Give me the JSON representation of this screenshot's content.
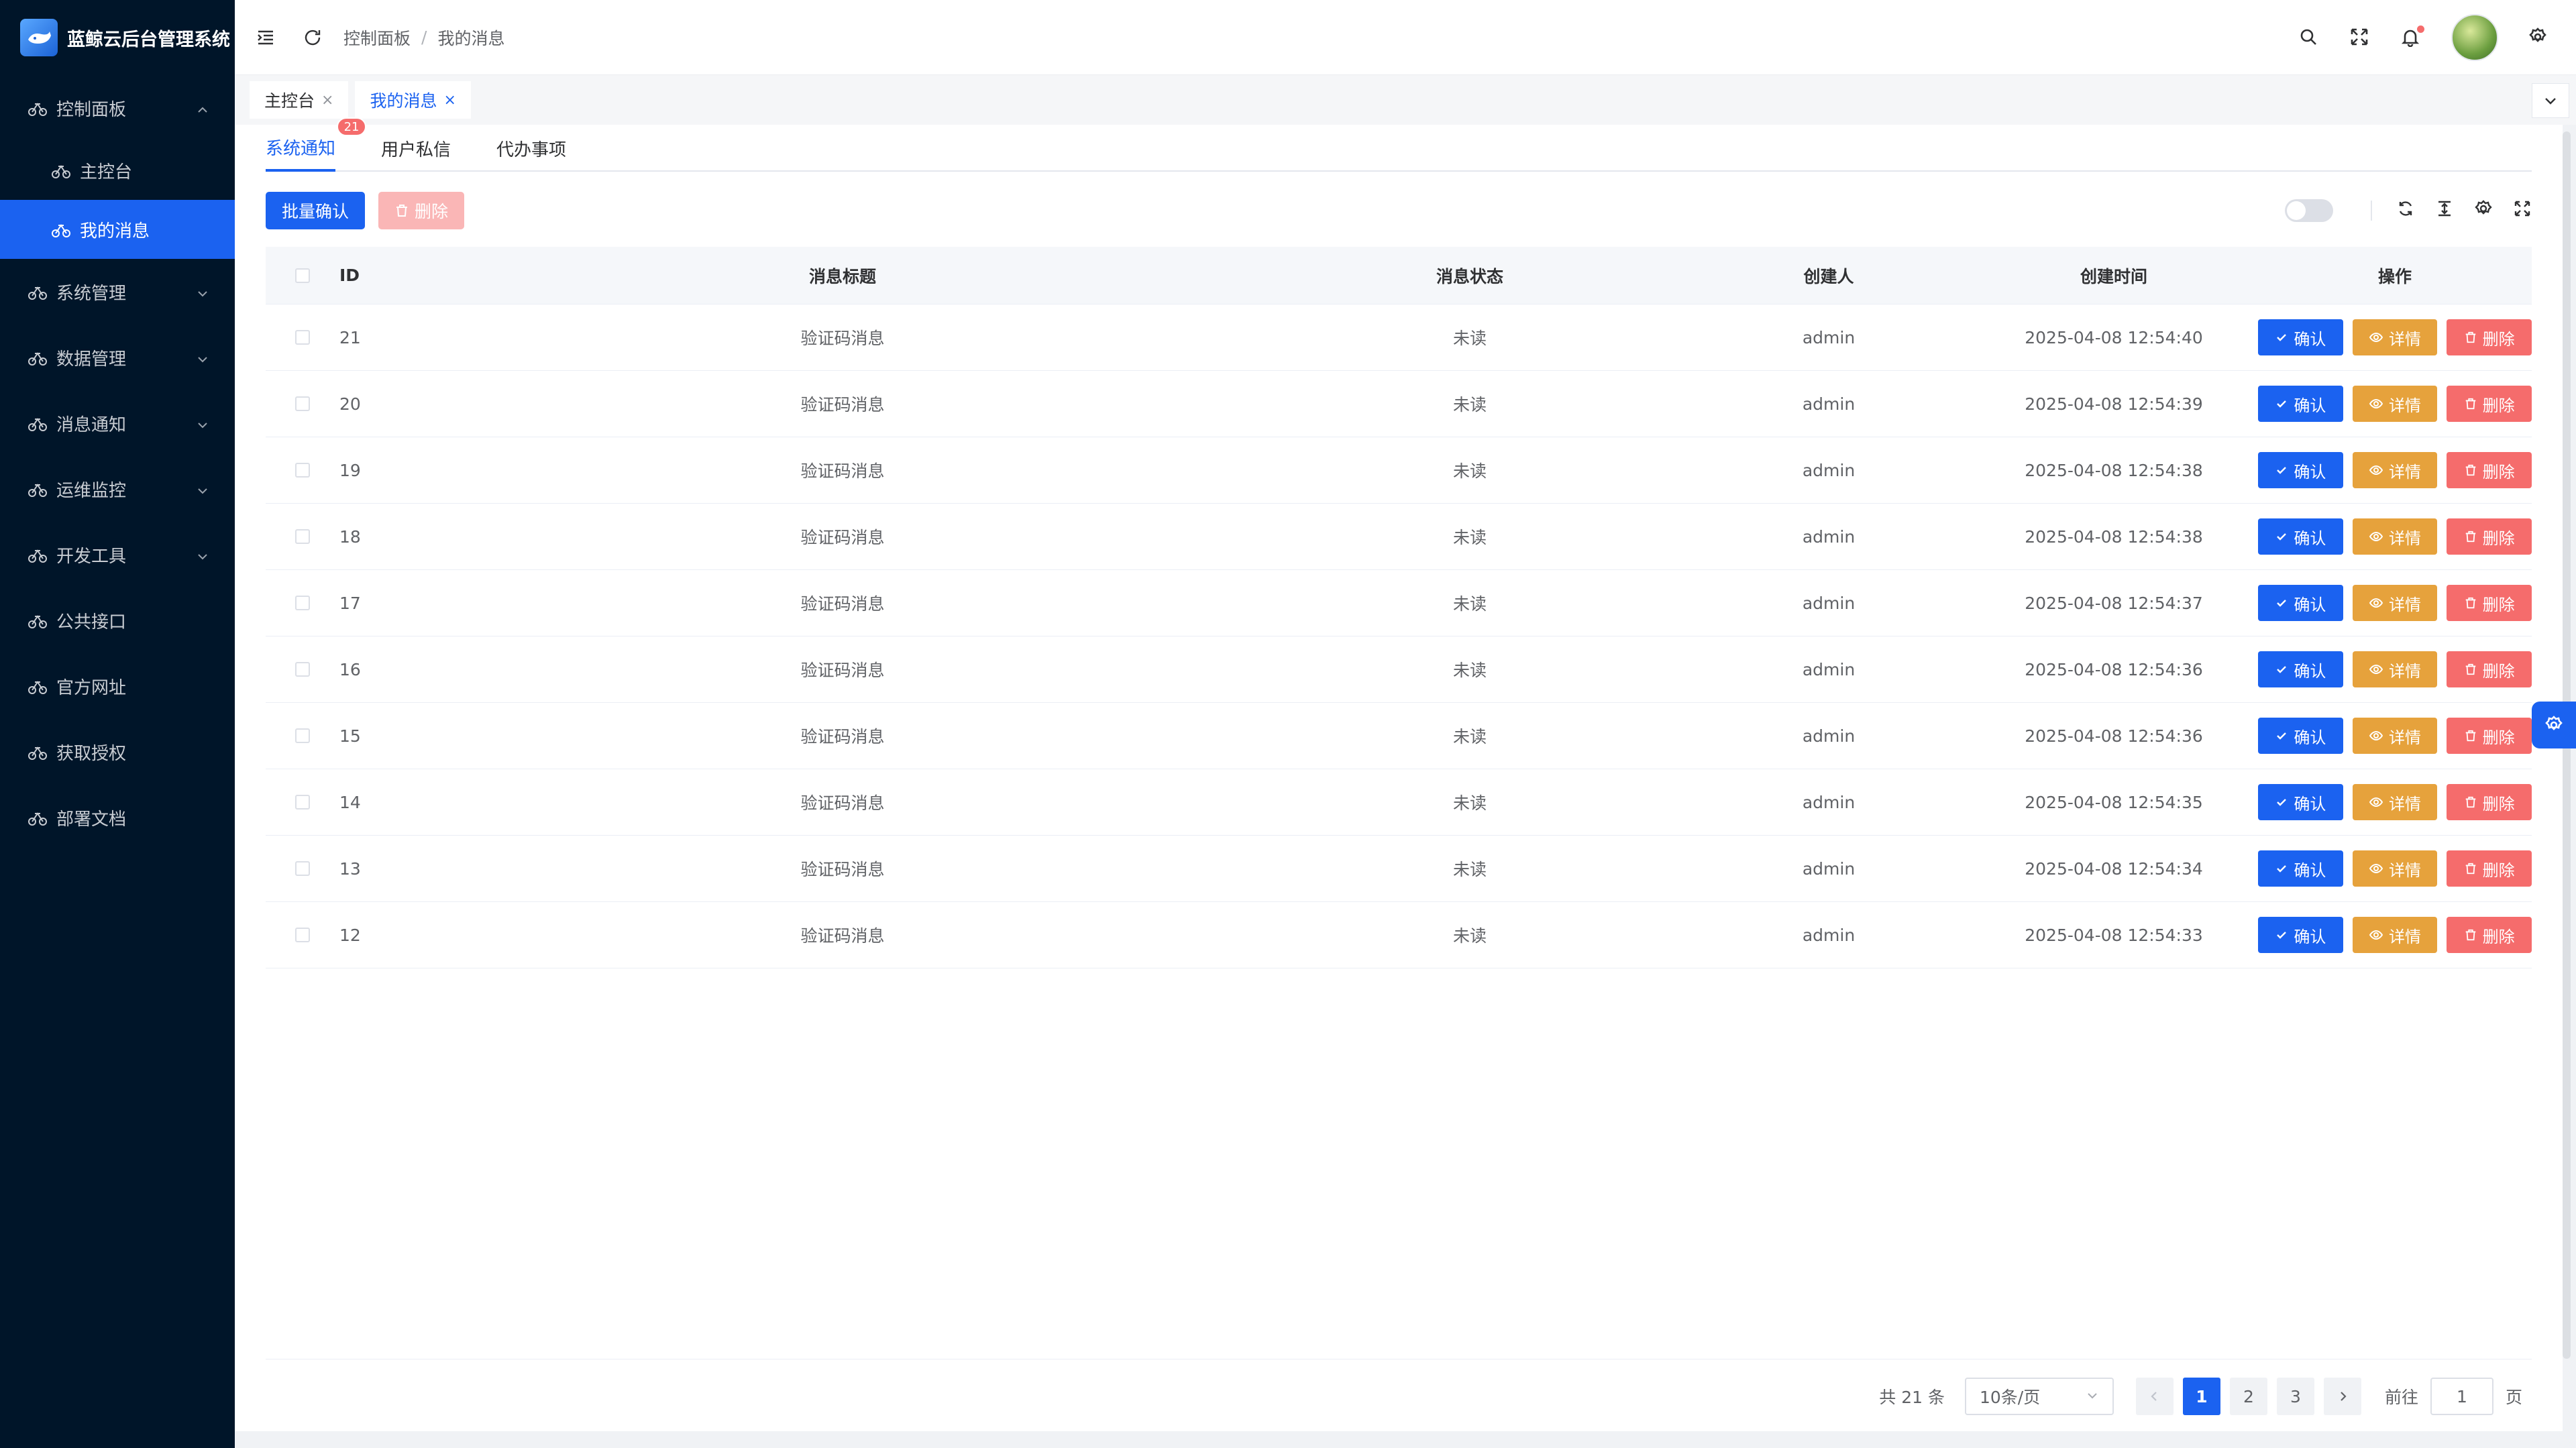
{
  "app": {
    "title": "蓝鲸云后台管理系统"
  },
  "sidebar": {
    "items": [
      {
        "label": "控制面板",
        "expanded": true
      },
      {
        "label": "主控台",
        "sub": true
      },
      {
        "label": "我的消息",
        "sub": true,
        "active": true
      },
      {
        "label": "系统管理",
        "hasChildren": true
      },
      {
        "label": "数据管理",
        "hasChildren": true
      },
      {
        "label": "消息通知",
        "hasChildren": true
      },
      {
        "label": "运维监控",
        "hasChildren": true
      },
      {
        "label": "开发工具",
        "hasChildren": true
      },
      {
        "label": "公共接口"
      },
      {
        "label": "官方网址"
      },
      {
        "label": "获取授权"
      },
      {
        "label": "部署文档"
      }
    ]
  },
  "header": {
    "breadcrumb": [
      "控制面板",
      "我的消息"
    ],
    "separator": "/"
  },
  "tags": [
    {
      "label": "主控台",
      "close": "×"
    },
    {
      "label": "我的消息",
      "close": "×",
      "active": true
    }
  ],
  "subtabs": [
    {
      "label": "系统通知",
      "badge": "21",
      "active": true
    },
    {
      "label": "用户私信"
    },
    {
      "label": "代办事项"
    }
  ],
  "toolbar": {
    "batch_confirm": "批量确认",
    "delete": "删除"
  },
  "table": {
    "headers": {
      "id": "ID",
      "title": "消息标题",
      "status": "消息状态",
      "creator": "创建人",
      "time": "创建时间",
      "ops": "操作"
    },
    "ops": {
      "confirm": "确认",
      "detail": "详情",
      "delete": "删除"
    },
    "rows": [
      {
        "id": "21",
        "title": "验证码消息",
        "status": "未读",
        "creator": "admin",
        "time": "2025-04-08 12:54:40"
      },
      {
        "id": "20",
        "title": "验证码消息",
        "status": "未读",
        "creator": "admin",
        "time": "2025-04-08 12:54:39"
      },
      {
        "id": "19",
        "title": "验证码消息",
        "status": "未读",
        "creator": "admin",
        "time": "2025-04-08 12:54:38"
      },
      {
        "id": "18",
        "title": "验证码消息",
        "status": "未读",
        "creator": "admin",
        "time": "2025-04-08 12:54:38"
      },
      {
        "id": "17",
        "title": "验证码消息",
        "status": "未读",
        "creator": "admin",
        "time": "2025-04-08 12:54:37"
      },
      {
        "id": "16",
        "title": "验证码消息",
        "status": "未读",
        "creator": "admin",
        "time": "2025-04-08 12:54:36"
      },
      {
        "id": "15",
        "title": "验证码消息",
        "status": "未读",
        "creator": "admin",
        "time": "2025-04-08 12:54:36"
      },
      {
        "id": "14",
        "title": "验证码消息",
        "status": "未读",
        "creator": "admin",
        "time": "2025-04-08 12:54:35"
      },
      {
        "id": "13",
        "title": "验证码消息",
        "status": "未读",
        "creator": "admin",
        "time": "2025-04-08 12:54:34"
      },
      {
        "id": "12",
        "title": "验证码消息",
        "status": "未读",
        "creator": "admin",
        "time": "2025-04-08 12:54:33"
      }
    ]
  },
  "pagination": {
    "total": "共 21 条",
    "page_size": "10条/页",
    "pages": [
      "1",
      "2",
      "3"
    ],
    "current": "1",
    "goto_label": "前往",
    "goto_value": "1",
    "page_unit": "页"
  },
  "colors": {
    "primary": "#1b62f0",
    "warning": "#e6a23c",
    "danger": "#f56c6c",
    "sidebar": "#001529"
  }
}
